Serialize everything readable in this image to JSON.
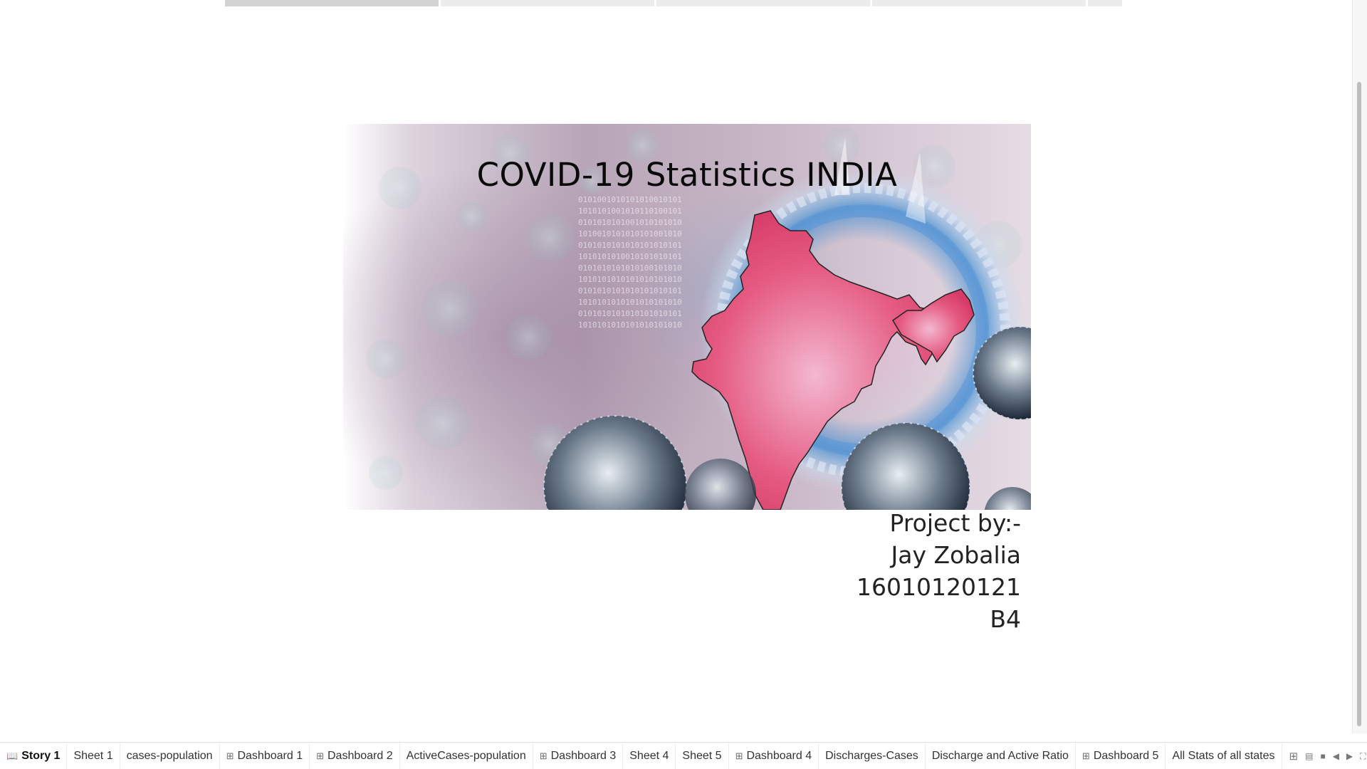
{
  "story": {
    "title": "COVID-19 Statistics INDIA",
    "credits": [
      "Project by:-",
      "Jay Zobalia",
      "16010120121",
      "B4"
    ],
    "navigator_points": 5,
    "active_point": 0
  },
  "tabs": [
    {
      "label": "Story 1",
      "icon": "story-icon",
      "active": true
    },
    {
      "label": "Sheet 1",
      "icon": "",
      "active": false
    },
    {
      "label": "cases-population",
      "icon": "",
      "active": false
    },
    {
      "label": "Dashboard 1",
      "icon": "dashboard-icon",
      "active": false
    },
    {
      "label": "Dashboard 2",
      "icon": "dashboard-icon",
      "active": false
    },
    {
      "label": "ActiveCases-population",
      "icon": "",
      "active": false
    },
    {
      "label": "Dashboard 3",
      "icon": "dashboard-icon",
      "active": false
    },
    {
      "label": "Sheet 4",
      "icon": "",
      "active": false
    },
    {
      "label": "Sheet 5",
      "icon": "",
      "active": false
    },
    {
      "label": "Dashboard 4",
      "icon": "dashboard-icon",
      "active": false
    },
    {
      "label": "Discharges-Cases",
      "icon": "",
      "active": false
    },
    {
      "label": "Discharge and Active Ratio",
      "icon": "",
      "active": false
    },
    {
      "label": "Dashboard 5",
      "icon": "dashboard-icon",
      "active": false
    },
    {
      "label": "All Stats of all states",
      "icon": "",
      "active": false
    }
  ],
  "tab_controls": {
    "new_tab_icon": "new-dashboard-icon",
    "icons": [
      "show-filmstrip-icon",
      "show-tabs-icon",
      "prev-tab-icon",
      "next-tab-icon",
      "fullscreen-icon",
      "presentation-icon"
    ]
  },
  "colors": {
    "map_fill": "#e24a73",
    "map_outline": "#222222"
  }
}
